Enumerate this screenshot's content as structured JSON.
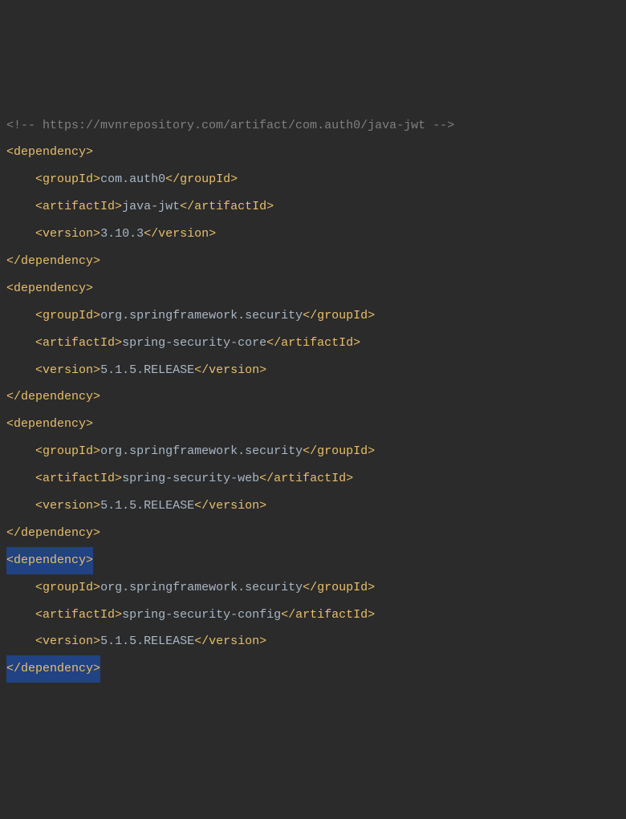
{
  "comment": "<!-- https://mvnrepository.com/artifact/com.auth0/java-jwt -->",
  "tags": {
    "dependency_open": "dependency",
    "dependency_close": "dependency",
    "groupId": "groupId",
    "artifactId": "artifactId",
    "version": "version"
  },
  "dependencies": [
    {
      "groupId": "com.auth0",
      "artifactId": "java-jwt",
      "version": "3.10.3",
      "highlighted": false
    },
    {
      "groupId": "org.springframework.security",
      "artifactId": "spring-security-core",
      "version": "5.1.5.RELEASE",
      "highlighted": false
    },
    {
      "groupId": "org.springframework.security",
      "artifactId": "spring-security-web",
      "version": "5.1.5.RELEASE",
      "highlighted": false
    },
    {
      "groupId": "org.springframework.security",
      "artifactId": "spring-security-config",
      "version": "5.1.5.RELEASE",
      "highlighted": true
    }
  ]
}
